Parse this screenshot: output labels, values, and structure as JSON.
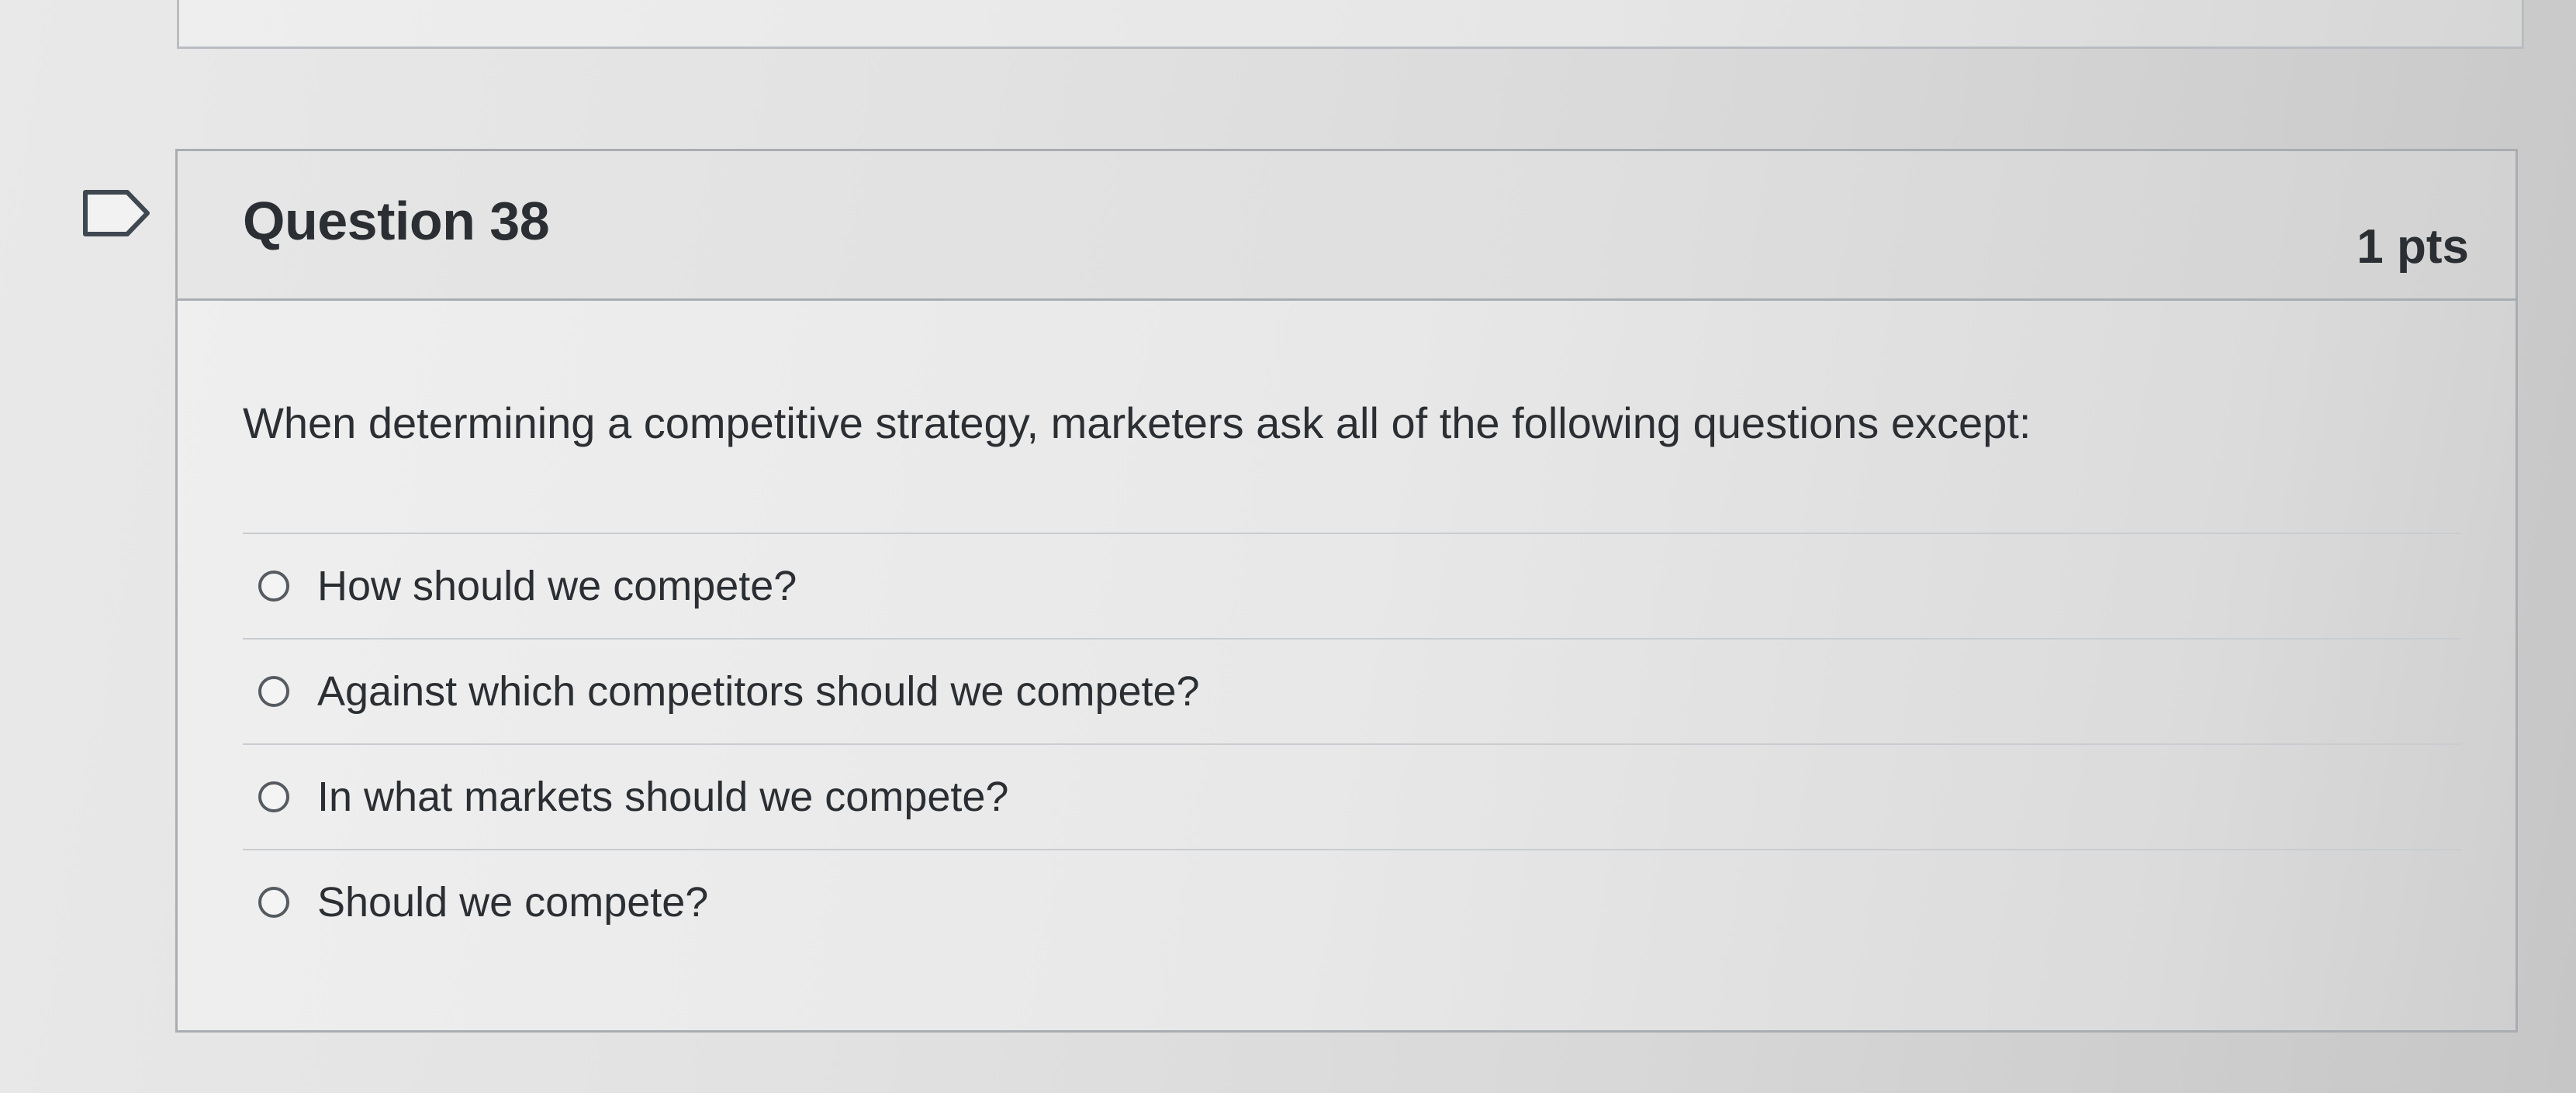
{
  "question": {
    "title": "Question 38",
    "points": "1 pts",
    "text": "When determining a competitive strategy, marketers ask all of the following questions except:",
    "answers": [
      {
        "label": "How should we compete?",
        "selected": false
      },
      {
        "label": "Against which competitors should we compete?",
        "selected": false
      },
      {
        "label": "In what markets should we compete?",
        "selected": false
      },
      {
        "label": "Should we compete?",
        "selected": false
      }
    ]
  },
  "icons": {
    "flag": "flag-icon",
    "radio": "radio-unchecked-icon"
  },
  "colors": {
    "text": "#2b2f33",
    "border": "#a9adb2",
    "background": "#e6e6e6"
  }
}
